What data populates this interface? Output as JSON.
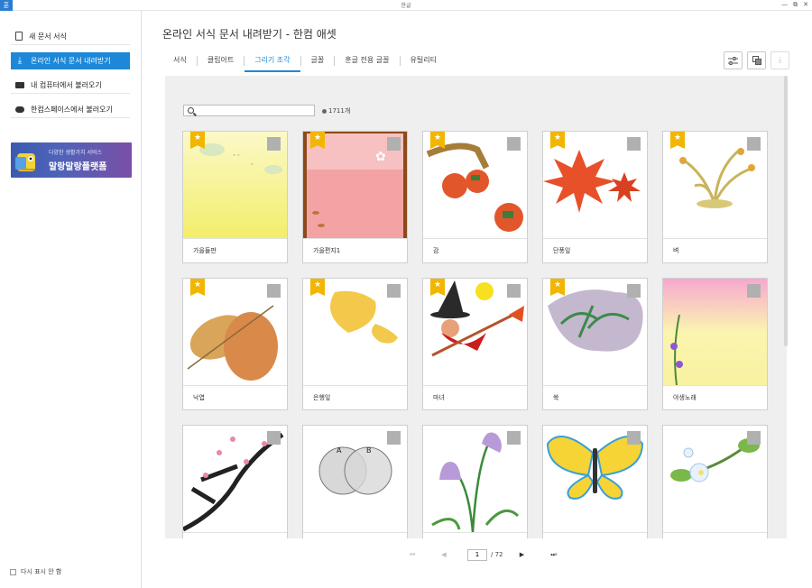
{
  "window": {
    "title": "한글",
    "app_icon_glyph": "훈",
    "controls": [
      "—",
      "⧉",
      "✕"
    ]
  },
  "sidebar": {
    "items": [
      {
        "label": "새 문서 서식",
        "icon": "document-icon"
      },
      {
        "label": "온라인 서식 문서 내려받기",
        "icon": "download-icon",
        "active": true
      },
      {
        "label": "내 컴퓨터에서 불러오기",
        "icon": "folder-icon"
      },
      {
        "label": "한컴스페이스에서 불러오기",
        "icon": "cloud-icon"
      }
    ],
    "banner": {
      "line1": "다양한 생활가치 서비스",
      "line2": "말랑말랑플랫폼"
    },
    "dont_show_label": "다시 표시 안 함"
  },
  "main": {
    "title": "온라인 서식 문서 내려받기 - 한컴 애셋",
    "tabs": [
      {
        "label": "서식"
      },
      {
        "label": "클립아트"
      },
      {
        "label": "그리기 조각",
        "active": true
      },
      {
        "label": "글꼴"
      },
      {
        "label": "훈글 전용 글꼴"
      },
      {
        "label": "유틸리티"
      }
    ],
    "toolbar": {
      "filter_icon": "sliders-icon",
      "copy_icon": "copy-icon",
      "download_icon": "download-icon"
    },
    "search": {
      "placeholder": "",
      "value": ""
    },
    "count_label": "1711개",
    "items": [
      {
        "caption": "가을들판",
        "starred": true
      },
      {
        "caption": "가을편지1",
        "starred": true
      },
      {
        "caption": "감",
        "starred": true
      },
      {
        "caption": "단풍잎",
        "starred": true
      },
      {
        "caption": "벼",
        "starred": true
      },
      {
        "caption": "낙엽",
        "starred": true
      },
      {
        "caption": "은행잎",
        "starred": true
      },
      {
        "caption": "마녀",
        "starred": true
      },
      {
        "caption": "쑥",
        "starred": true
      },
      {
        "caption": "야생노래",
        "starred": false
      },
      {
        "caption": "",
        "starred": false
      },
      {
        "caption": "",
        "starred": false
      },
      {
        "caption": "",
        "starred": false
      },
      {
        "caption": "",
        "starred": false
      },
      {
        "caption": "",
        "starred": false
      }
    ],
    "venn_labels": [
      "A",
      "B"
    ],
    "pagination": {
      "first": "⏮",
      "prev": "◀",
      "current": "1",
      "total": "/ 72",
      "next": "▶",
      "last": "⏭"
    }
  },
  "colors": {
    "accent": "#1e88d8",
    "star": "#f2b500",
    "content_bg": "#efefef"
  }
}
